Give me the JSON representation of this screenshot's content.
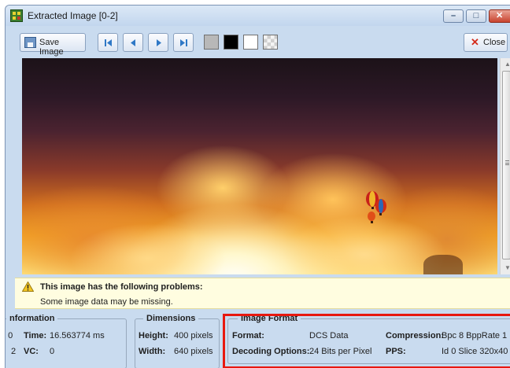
{
  "window": {
    "title": "Extracted Image [0-2]",
    "controls": {
      "minimize": "–",
      "maximize": "□",
      "close": "✕"
    }
  },
  "toolbar": {
    "save_label": "Save Image",
    "save_icon": "save-image-icon",
    "nav_buttons": [
      "first-frame-icon",
      "previous-frame-icon",
      "next-frame-icon",
      "last-frame-icon"
    ],
    "background_swatches": [
      "#b8b8b8",
      "#000000",
      "#ffffff",
      "checkerboard"
    ],
    "close_label": "Close",
    "close_icon": "close-x-icon"
  },
  "warning": {
    "icon": "warning-triangle-icon",
    "title": "This image has the following problems:",
    "detail": "Some image data may be missing."
  },
  "info_panel": {
    "legend": "nformation",
    "rows": [
      {
        "prefix": ": 0",
        "label": "Time:",
        "value": "16.563774 ms"
      },
      {
        "prefix": "2",
        "label": "VC:",
        "value": "0"
      }
    ]
  },
  "dimensions_panel": {
    "legend": "Dimensions",
    "height_label": "Height:",
    "height_value": "400 pixels",
    "width_label": "Width:",
    "width_value": "640 pixels"
  },
  "format_panel": {
    "legend": "Image Format",
    "format_label": "Format:",
    "format_value": "DCS Data",
    "decoding_label": "Decoding Options:",
    "decoding_value": "24 Bits per Pixel",
    "compression_label": "Compression:",
    "compression_value": "Bpc 8 BppRate 1",
    "pps_label": "PPS:",
    "pps_value": "Id 0 Slice 320x40"
  },
  "colors": {
    "highlight": "#e8180f",
    "chrome": "#c9dbef"
  }
}
